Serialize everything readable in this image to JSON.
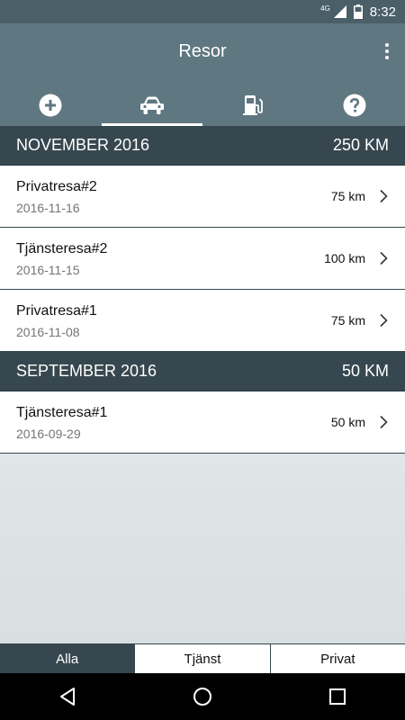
{
  "status": {
    "network": "4G",
    "time": "8:32"
  },
  "appbar": {
    "title": "Resor"
  },
  "tabs": [
    {
      "icon": "add-circle-icon",
      "active": false
    },
    {
      "icon": "car-icon",
      "active": true
    },
    {
      "icon": "fuel-pump-icon",
      "active": false
    },
    {
      "icon": "help-circle-icon",
      "active": false
    }
  ],
  "sections": [
    {
      "month": "NOVEMBER 2016",
      "total": "250 KM",
      "trips": [
        {
          "name": "Privatresa#2",
          "date": "2016-11-16",
          "distance": "75 km"
        },
        {
          "name": "Tjänsteresa#2",
          "date": "2016-11-15",
          "distance": "100 km"
        },
        {
          "name": "Privatresa#1",
          "date": "2016-11-08",
          "distance": "75 km"
        }
      ]
    },
    {
      "month": "SEPTEMBER 2016",
      "total": "50 KM",
      "trips": [
        {
          "name": "Tjänsteresa#1",
          "date": "2016-09-29",
          "distance": "50 km"
        }
      ]
    }
  ],
  "filter": {
    "selected": "Alla",
    "options": [
      "Alla",
      "Tjänst",
      "Privat"
    ]
  },
  "colors": {
    "appbar": "#5f7780",
    "statusbar": "#4a5f68",
    "section_header": "#36474f"
  }
}
